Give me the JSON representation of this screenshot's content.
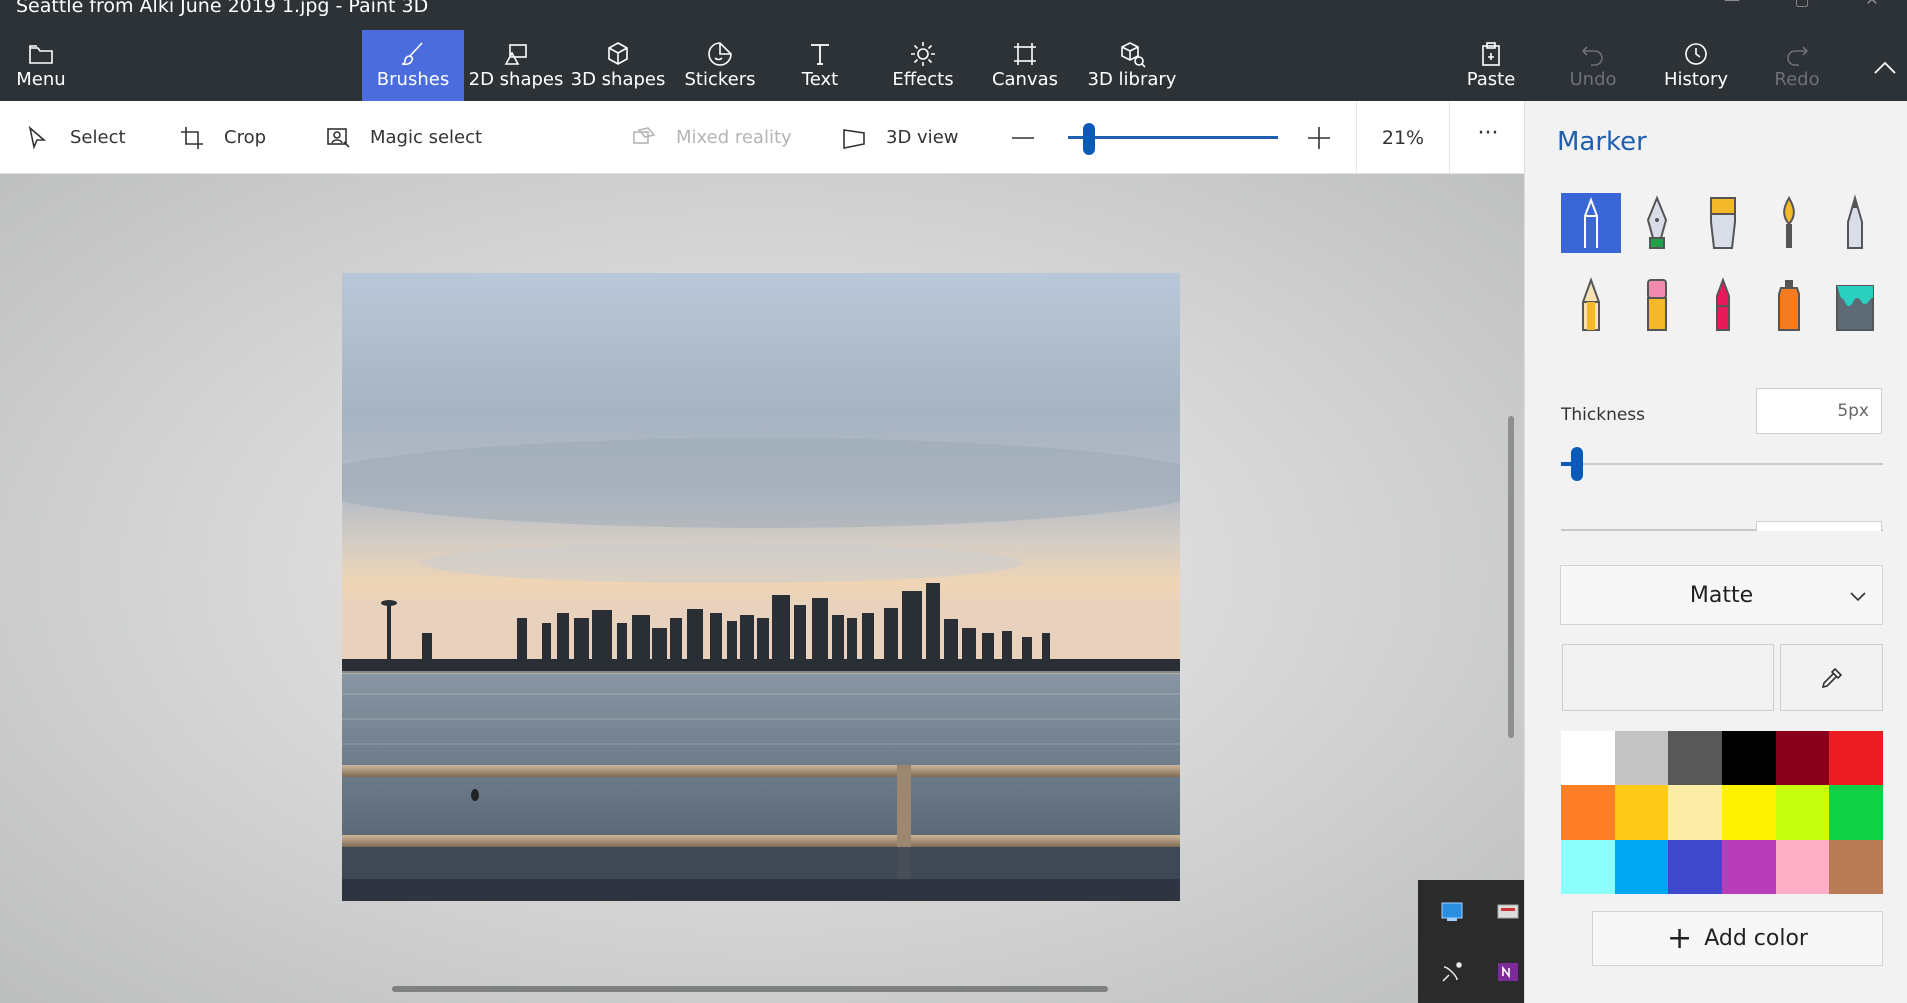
{
  "window": {
    "title": "Seattle from Alki June 2019 1.jpg - Paint 3D"
  },
  "toolbar": {
    "menu": "Menu",
    "brushes": "Brushes",
    "shapes2d": "2D shapes",
    "shapes3d": "3D shapes",
    "stickers": "Stickers",
    "text": "Text",
    "effects": "Effects",
    "canvas": "Canvas",
    "library3d": "3D library",
    "paste": "Paste",
    "undo": "Undo",
    "history": "History",
    "redo": "Redo",
    "active_tab": "Brushes"
  },
  "subtoolbar": {
    "select": "Select",
    "crop": "Crop",
    "magic_select": "Magic select",
    "mixed_reality": "Mixed reality",
    "view3d": "3D view",
    "zoom_value": "21%",
    "zoom_level": 0.1,
    "more": "···"
  },
  "panel": {
    "title": "Marker",
    "brushes": [
      {
        "name": "marker",
        "active": true
      },
      {
        "name": "calligraphy-pen",
        "active": false
      },
      {
        "name": "oil-brush",
        "active": false
      },
      {
        "name": "watercolor",
        "active": false
      },
      {
        "name": "pixel-pen",
        "active": false
      },
      {
        "name": "pencil",
        "active": false
      },
      {
        "name": "eraser",
        "active": false
      },
      {
        "name": "crayon",
        "active": false
      },
      {
        "name": "spray-can",
        "active": false
      },
      {
        "name": "fill",
        "active": false
      }
    ],
    "thickness_label": "Thickness",
    "thickness_value": "5px",
    "thickness_level": 0.05,
    "finish": "Matte",
    "add_color": "Add color",
    "selected_color": "#f2f2f2",
    "palette": [
      "#ffffff",
      "#c3c3c3",
      "#585858",
      "#000000",
      "#88001b",
      "#ec1c24",
      "#ff7f27",
      "#ffca18",
      "#fdeca6",
      "#fff200",
      "#c4ff0e",
      "#0ed145",
      "#8cfffb",
      "#00a8f3",
      "#3f48cc",
      "#b83dba",
      "#ffaec8",
      "#b97a56"
    ]
  },
  "colors": {
    "accent": "#4a6cdc",
    "slider": "#0a5ab8",
    "title_blue": "#1f5fb0"
  }
}
